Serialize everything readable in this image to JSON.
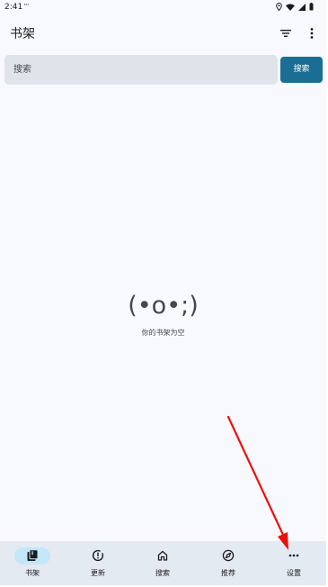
{
  "status_bar": {
    "time": "2:41",
    "dots": "···",
    "icons": [
      "location-icon",
      "wifi-icon",
      "signal-icon",
      "battery-icon"
    ]
  },
  "top_bar": {
    "title": "书架",
    "actions": [
      "filter-icon",
      "more-vert-icon"
    ]
  },
  "search": {
    "placeholder": "搜索",
    "button_label": "搜索"
  },
  "empty_state": {
    "face": "(•o•;)",
    "message": "你的书架为空"
  },
  "bottom_nav": {
    "items": [
      {
        "label": "书架",
        "icon": "library-icon",
        "active": true
      },
      {
        "label": "更新",
        "icon": "update-icon",
        "active": false
      },
      {
        "label": "搜索",
        "icon": "home-icon",
        "active": false
      },
      {
        "label": "推荐",
        "icon": "compass-icon",
        "active": false
      },
      {
        "label": "设置",
        "icon": "more-horiz-icon",
        "active": false
      }
    ]
  },
  "colors": {
    "background": "#f8f9ff",
    "search_field": "#dfe3ea",
    "accent_button": "#1a6e93",
    "nav_background": "#e4eaf2",
    "nav_active_pill": "#c3e6f8",
    "annotation_arrow": "#e8120c"
  }
}
